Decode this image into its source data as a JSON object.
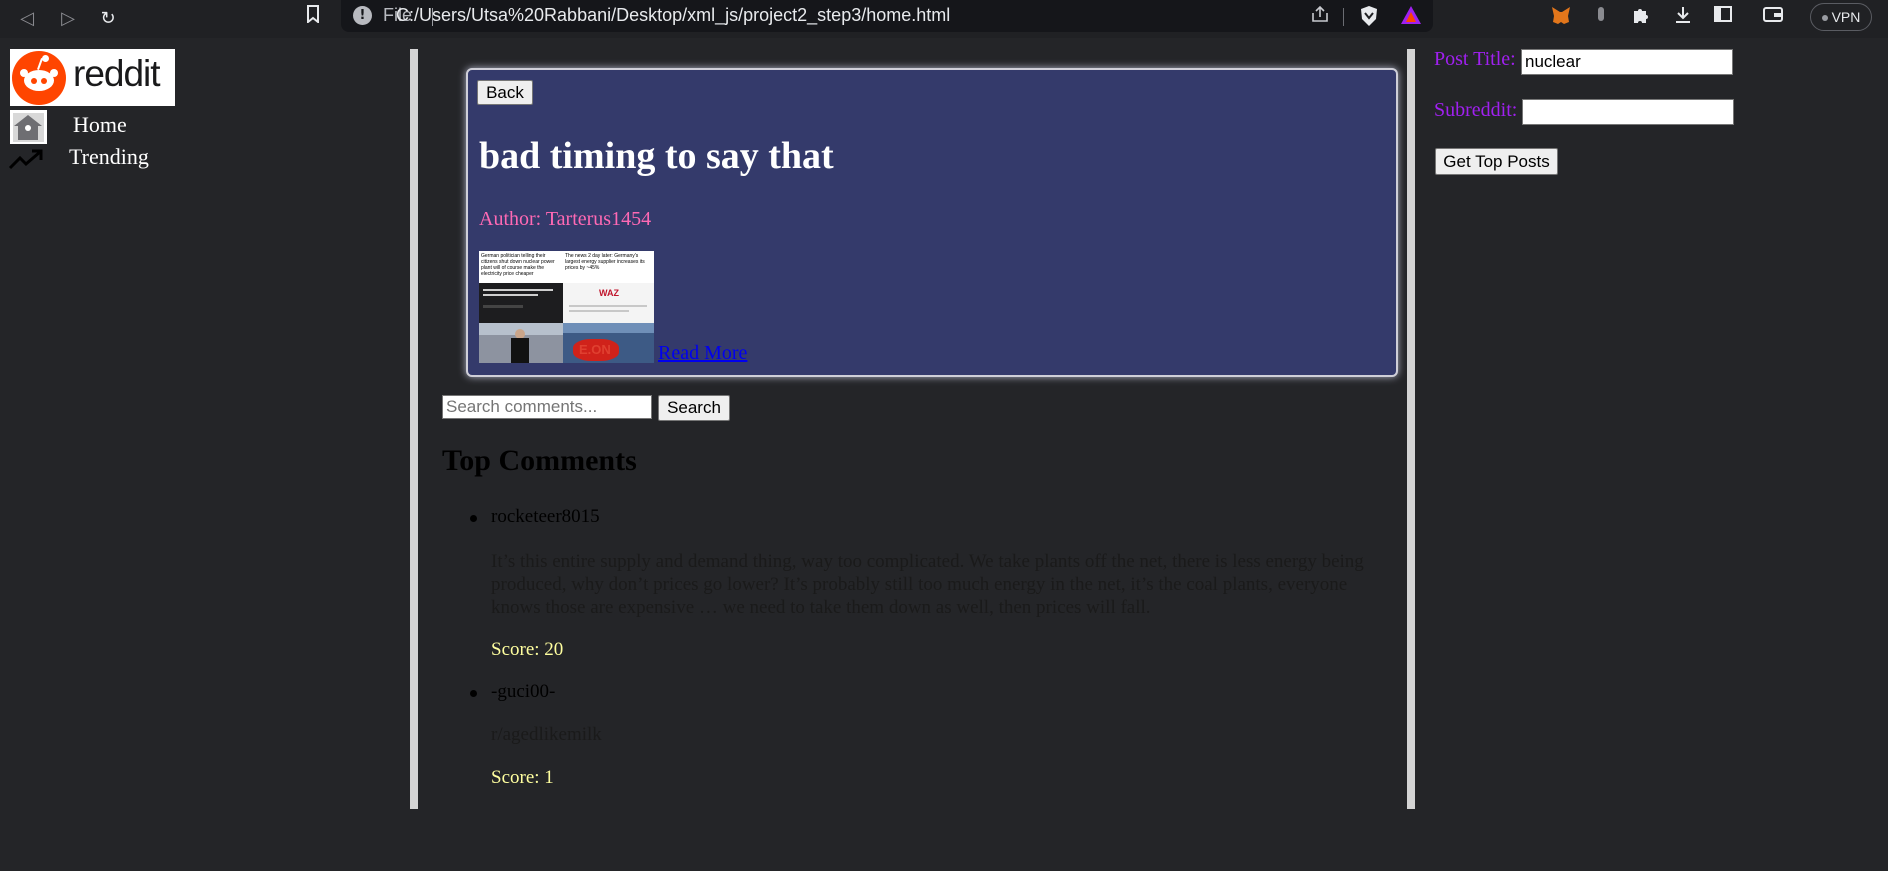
{
  "browser": {
    "url_scheme": "File",
    "url": "C:/Users/Utsa%20Rabbani/Desktop/xml_js/project2_step3/home.html",
    "vpn_label": "VPN"
  },
  "sidebar": {
    "logo_text": "reddit",
    "items": [
      {
        "label": "Home",
        "icon": "home-icon"
      },
      {
        "label": "Trending",
        "icon": "trending-icon"
      }
    ]
  },
  "post": {
    "back_label": "Back",
    "title": "bad timing to say that",
    "author": "Author: Tarterus1454",
    "read_more": "Read More",
    "thumbnail": {
      "left_caption": "German politician telling their citizens shut down nuclear power plant will of course make the electricity price cheaper",
      "right_caption": "The news 2 day later: Germany's largest energy supplier increases its prices by ~45%",
      "logo_text": "WAZ",
      "sign_text": "E.ON"
    }
  },
  "comments": {
    "search_placeholder": "Search comments...",
    "search_button": "Search",
    "heading": "Top Comments",
    "items": [
      {
        "author": "rocketeer8015",
        "body": "It’s this entire supply and demand thing, way too complicated. We take plants off the net, there is less energy being produced, why don’t prices go lower? It’s probably still too much energy in the net, it’s the coal plants, everyone knows those are expensive … we need to take them down as well, then prices will fall.",
        "score": "Score: 20"
      },
      {
        "author": "-guci00-",
        "body": "r/agedlikemilk",
        "score": "Score: 1"
      }
    ]
  },
  "filters": {
    "post_title_label": "Post Title:",
    "post_title_value": "nuclear",
    "subreddit_label": "Subreddit:",
    "subreddit_value": "",
    "submit_label": "Get Top Posts"
  },
  "colors": {
    "page_bg": "#242528",
    "card_bg": "#343a6b",
    "author": "#ff69b4",
    "score": "#ffff9f",
    "filter_label": "#a020f0"
  }
}
